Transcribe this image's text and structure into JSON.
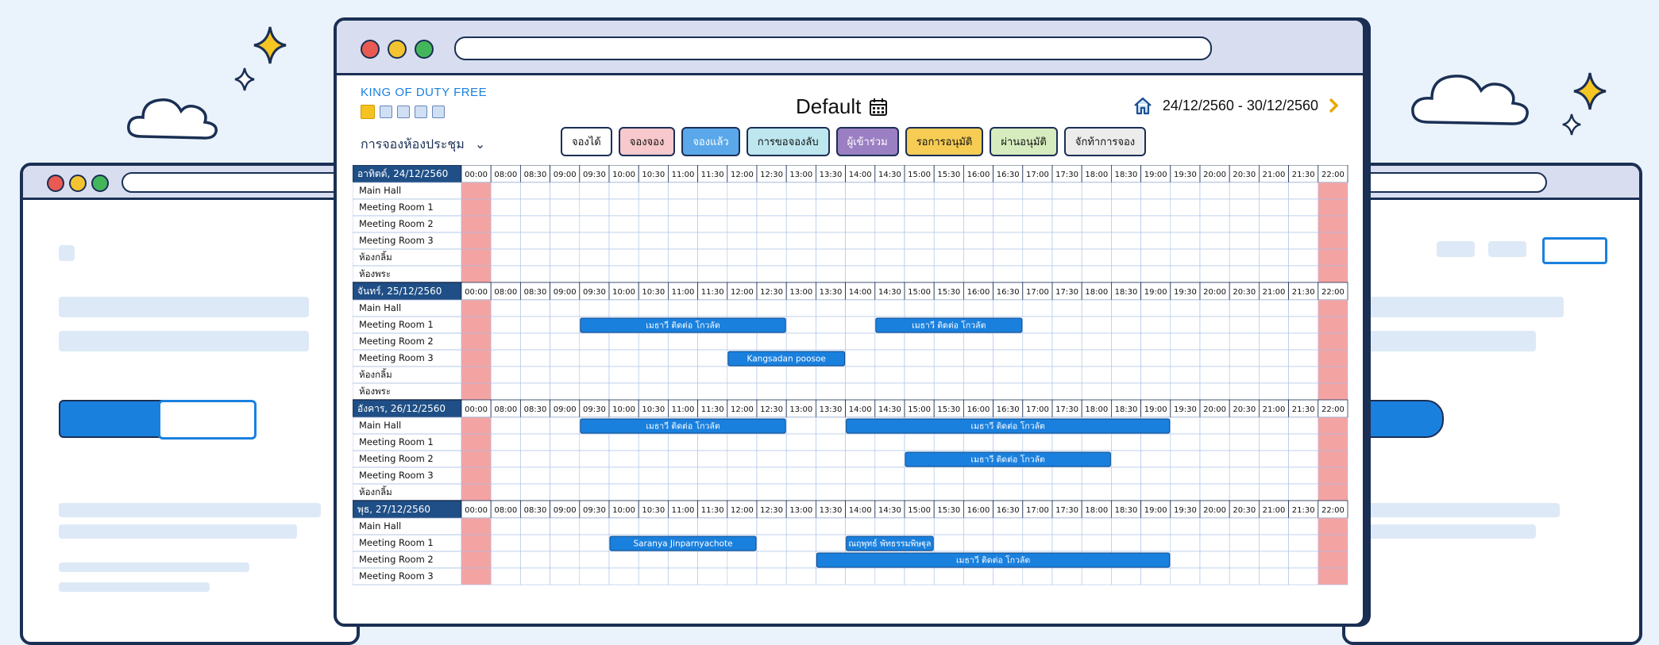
{
  "brand": "KING OF DUTY FREE",
  "section_title": "การจองห้องประชุม",
  "calendar_title": "Default",
  "date_range": "24/12/2560 - 30/12/2560",
  "legend": [
    {
      "label": "จองได้",
      "color": "#ffffff"
    },
    {
      "label": "จองจอง",
      "color": "#f7c8cc"
    },
    {
      "label": "จองแล้ว",
      "color": "#5aa8ea"
    },
    {
      "label": "การขอจองลับ",
      "color": "#bde6ee"
    },
    {
      "label": "ผู้เข้าร่วม",
      "color": "#9b7fc3"
    },
    {
      "label": "รอการอนุมัติ",
      "color": "#f6cc55"
    },
    {
      "label": "ผ่านอนุมัติ",
      "color": "#d6ecbf"
    },
    {
      "label": "จักท้าการจอง",
      "color": "#ececec"
    }
  ],
  "times": [
    "00:00",
    "08:00",
    "08:30",
    "09:00",
    "09:30",
    "10:00",
    "10:30",
    "11:00",
    "11:30",
    "12:00",
    "12:30",
    "13:00",
    "13:30",
    "14:00",
    "14:30",
    "15:00",
    "15:30",
    "16:00",
    "16:30",
    "17:00",
    "17:30",
    "18:00",
    "18:30",
    "19:00",
    "19:30",
    "20:00",
    "20:30",
    "21:00",
    "21:30",
    "22:00"
  ],
  "days": [
    {
      "label": "อาทิตต์, 24/12/2560",
      "rooms": [
        "Main Hall",
        "Meeting Room 1",
        "Meeting Room 2",
        "Meeting Room 3",
        "ห้องกลิ้ม",
        "ห้องพระ"
      ],
      "bookings": []
    },
    {
      "label": "จันทร์, 25/12/2560",
      "rooms": [
        "Main Hall",
        "Meeting Room 1",
        "Meeting Room 2",
        "Meeting Room 3",
        "ห้องกลิ้ม",
        "ห้องพระ"
      ],
      "bookings": [
        {
          "room": 1,
          "start": "09:30",
          "end": "13:00",
          "label": "เมธาวี ติดต่อ โกวลัต"
        },
        {
          "room": 1,
          "start": "14:30",
          "end": "17:00",
          "label": "เมธาวี ติดต่อ โกวลัต"
        },
        {
          "room": 3,
          "start": "12:00",
          "end": "14:00",
          "label": "Kangsadan poosoe"
        }
      ]
    },
    {
      "label": "อังคาร, 26/12/2560",
      "rooms": [
        "Main Hall",
        "Meeting Room 1",
        "Meeting Room 2",
        "Meeting Room 3",
        "ห้องกลิ้ม"
      ],
      "bookings": [
        {
          "room": 0,
          "start": "09:30",
          "end": "13:00",
          "label": "เมธาวี ติดต่อ โกวลัต"
        },
        {
          "room": 0,
          "start": "14:00",
          "end": "19:30",
          "label": "เมธาวี ติดต่อ โกวลัต"
        },
        {
          "room": 2,
          "start": "15:00",
          "end": "18:30",
          "label": "เมธาวี ติดต่อ โกวลัต"
        }
      ]
    },
    {
      "label": "พุธ, 27/12/2560",
      "rooms": [
        "Main Hall",
        "Meeting Room 1",
        "Meeting Room 2",
        "Meeting Room 3"
      ],
      "bookings": [
        {
          "room": 1,
          "start": "10:00",
          "end": "12:30",
          "label": "Saranya Jinparnyachote"
        },
        {
          "room": 1,
          "start": "14:00",
          "end": "15:30",
          "label": "ณฤพุทธ์ พัทธรรมพิษฐุล"
        },
        {
          "room": 2,
          "start": "13:30",
          "end": "19:30",
          "label": "เมธาวี ติดต่อ โกวลัต"
        }
      ]
    }
  ],
  "colors": {
    "accent": "#1a80de",
    "navy": "#1b2f54",
    "off_col": "#f4a3a3",
    "grid": "#a9c0e6"
  }
}
